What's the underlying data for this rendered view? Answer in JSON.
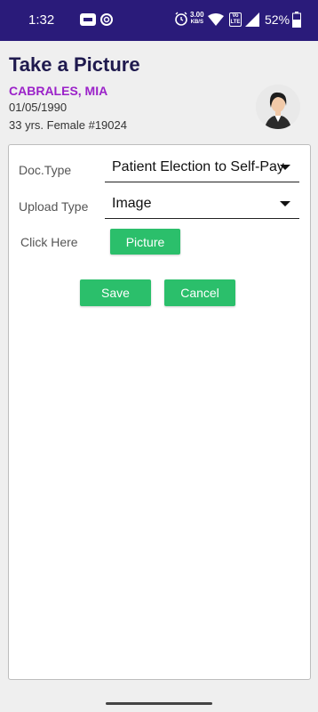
{
  "status_bar": {
    "time": "1:32",
    "speed_value": "3.00",
    "speed_unit": "KB/S",
    "lte_top": "Vo",
    "lte_bottom": "LTE",
    "battery": "52%"
  },
  "header": {
    "title": "Take a Picture",
    "patient_name": "CABRALES, MIA",
    "dob": "01/05/1990",
    "info": "33 yrs. Female #19024"
  },
  "form": {
    "doc_type_label": "Doc.Type",
    "doc_type_value": "Patient Election to Self-Pay",
    "upload_type_label": "Upload Type",
    "upload_type_value": "Image",
    "click_here_label": "Click Here",
    "picture_button": "Picture",
    "save_button": "Save",
    "cancel_button": "Cancel"
  },
  "colors": {
    "status_bar": "#2a1b7a",
    "title": "#1f1a4e",
    "patient_name": "#9b22c9",
    "button": "#2bbf6b"
  },
  "icons": [
    "sim-icon",
    "c-app-icon",
    "alarm-icon",
    "wifi-icon",
    "signal-icon",
    "battery-icon",
    "avatar-icon",
    "caret-down-icon"
  ]
}
